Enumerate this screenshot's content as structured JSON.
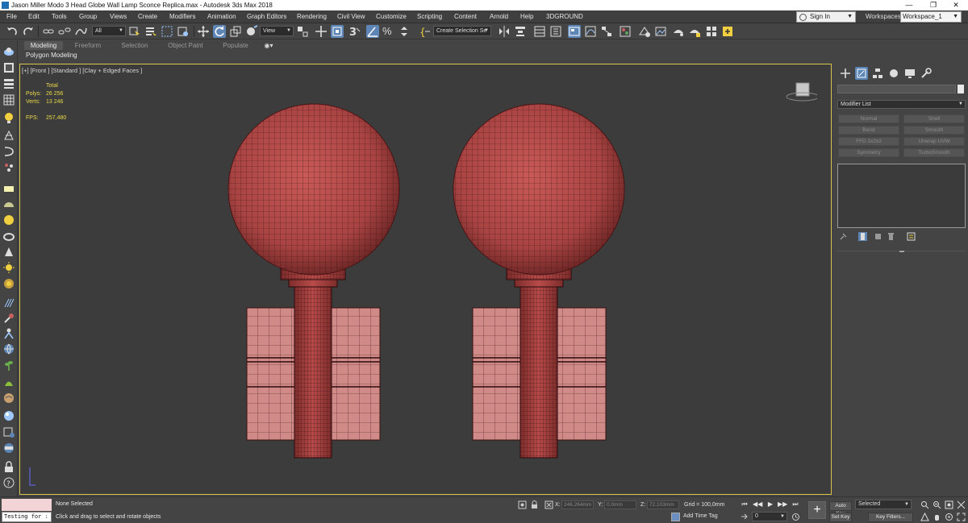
{
  "window": {
    "title": "Jason Miller Modo 3 Head Globe Wall Lamp Sconce Replica.max - Autodesk 3ds Max 2018",
    "minimize": "—",
    "restore": "❐",
    "close": "✕"
  },
  "menu": [
    "File",
    "Edit",
    "Tools",
    "Group",
    "Views",
    "Create",
    "Modifiers",
    "Animation",
    "Graph Editors",
    "Rendering",
    "Civil View",
    "Customize",
    "Scripting",
    "Content",
    "Arnold",
    "Help",
    "3DGROUND"
  ],
  "account": {
    "signin": "Sign In",
    "workspaces_label": "Workspaces:",
    "workspace": "Workspace_1"
  },
  "toolbar": {
    "selection_filter": "All",
    "ref_coord": "View",
    "named_selection": "Create Selection Se",
    "percent_snap": "%"
  },
  "ribbon": {
    "tabs": [
      "Modeling",
      "Freeform",
      "Selection",
      "Object Paint",
      "Populate"
    ],
    "active_tab": "Modeling",
    "panel": "Polygon Modeling"
  },
  "viewport": {
    "label": "[+] [Front ] [Standard ] [Clay + Edged Faces ]",
    "stats": {
      "total": "Total",
      "polys_label": "Polys:",
      "polys": "26 256",
      "verts_label": "Verts:",
      "verts": "13 246",
      "fps_label": "FPS:",
      "fps": "257,480"
    },
    "model_color": "#b54848",
    "border_color": "#d8c44e"
  },
  "command_panel": {
    "modifier_list": "Modifier List",
    "modifiers": [
      "Normal",
      "Shell",
      "Bend",
      "Smooth",
      "FFD 2x2x2",
      "Unwrap UVW",
      "Symmetry",
      "TurboSmooth"
    ]
  },
  "status": {
    "maxscript": "Testing for :",
    "selection": "None Selected",
    "prompt": "Click and drag to select and rotate objects",
    "x_label": "X:",
    "x": "246,264mm",
    "y_label": "Y:",
    "y": "0,0mm",
    "z_label": "Z:",
    "z": "72,103mm",
    "grid": "Grid = 100,0mm",
    "add_time_tag": "Add Time Tag",
    "auto_key": "Auto Key",
    "set_key": "Set Key",
    "key_mode": "Selected",
    "key_filters": "Key Filters...",
    "frame": "0"
  }
}
